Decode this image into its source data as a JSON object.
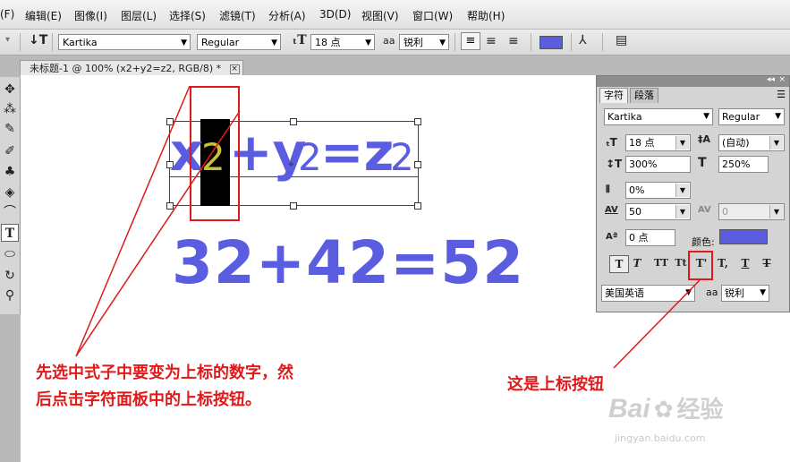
{
  "menu": [
    "(F)",
    "编辑(E)",
    "图像(I)",
    "图层(L)",
    "选择(S)",
    "滤镜(T)",
    "分析(A)",
    "3D(D)",
    "视图(V)",
    "窗口(W)",
    "帮助(H)"
  ],
  "options_bar": {
    "font_family": "Kartika",
    "font_style": "Regular",
    "font_size": "18 点",
    "antialias_label": "aa",
    "antialias": "锐利",
    "text_color": "#5a5de0"
  },
  "document_tab": "未标题-1 @ 100% (x2+y2=z2, RGB/8) *",
  "canvas": {
    "eq1": [
      "x",
      "2",
      "+y",
      "2",
      "=z",
      "2"
    ],
    "eq2": "32+42=52",
    "eq_color": "#5a5de0",
    "selection_color": "#c8c03a"
  },
  "char_panel": {
    "tab_char": "字符",
    "tab_para": "段落",
    "font_family": "Kartika",
    "font_style": "Regular",
    "font_size": "18 点",
    "leading": "(自动)",
    "vscale": "300%",
    "hscale": "250%",
    "tracking_pct": "0%",
    "tracking": "50",
    "kerning": "0",
    "baseline": "0 点",
    "color_label": "颜色:",
    "color": "#5a5de0",
    "language": "美国英语",
    "antialias_label": "aa",
    "antialias": "锐利",
    "format_buttons": [
      "T",
      "T",
      "TT",
      "Tt",
      "T'",
      "T,",
      "T",
      "T"
    ]
  },
  "annotations": {
    "left_line1": "先选中式子中要变为上标的数字，然",
    "left_line2": "后点击字符面板中的上标按钮。",
    "right": "这是上标按钮"
  },
  "watermark": {
    "brand": "Bai",
    "cn": "经验",
    "url": "jingyan.baidu.com"
  }
}
